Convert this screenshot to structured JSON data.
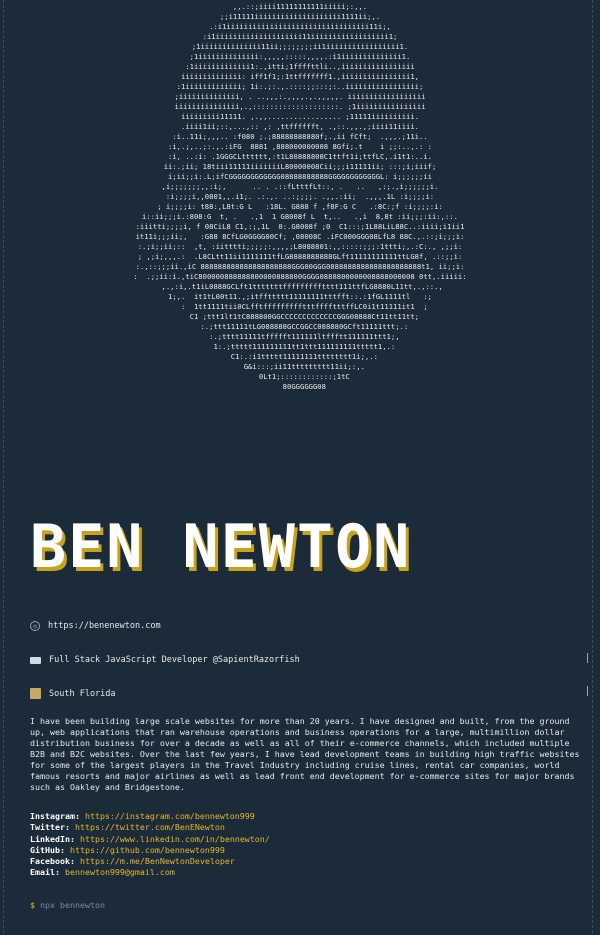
{
  "profile": {
    "name": "BEN NEWTON",
    "website": "https://benenewton.com",
    "title": "Full Stack JavaScript Developer @SapientRazorfish",
    "location": "South Florida",
    "bio": "I have been building large scale websites for more than 20 years. I have designed and built, from the ground up, web applications that ran warehouse operations and business operations for a large, multimillion dollar distribution business for over a decade as well as all of their e-commerce channels, which included multiple B2B and B2C websites. Over the last few years, I have lead development teams in building high traffic websites for some of the largest players in the Travel Industry including cruise lines, rental car companies, world famous resorts and major airlines as well as lead front end development for e-commerce sites for major brands such as Oakley and Bridgestone."
  },
  "icons": {
    "website": "globe-icon",
    "title": "laptop-icon",
    "location": "cityscape-icon"
  },
  "social": [
    {
      "label": "Instagram:",
      "url": "https://instagram.com/bennewton999"
    },
    {
      "label": "Twitter:",
      "url": "https://twitter.com/BenENewton"
    },
    {
      "label": "LinkedIn:",
      "url": "https://www.linkedin.com/in/bennewton/"
    },
    {
      "label": "GitHub:",
      "url": "https://github.com/bennewton999"
    },
    {
      "label": "Facebook:",
      "url": "https://m.me/BenNewtonDeveloper"
    },
    {
      "label": "Email:",
      "url": "bennewton999@gmail.com"
    }
  ],
  "terminal": {
    "prompt_symbol": "$",
    "command": "npx bennewton"
  },
  "ascii_portrait": ",,.::;iiii11111111111iiiii;:,,.\n;;i11111iiiiiiiiiiiiiiiiiiii1111ii;,.\n.:i1iiiiiiiiiiiiiiiiiiiiiiiiiiiiiiiii11i;,\n:i1iiiiiiiiiiiiiiiiiiii11iiiiiiiiiiiiiiiiii1;\n;1iiiiiiiiiiiiii11ii;;;;;;;;ii1iiiiiiiiiiiiiiiii1.\n;1iiiiiiiiiiiiii:,,,,,:::::,,,,.:i1iiiiiiiiiiiiii1.\n:1iiiiiiiiiiiii1:.,itti;1ffffttli..,iiiiiiiiiiiiiiiii\niiiiiiiiiiiiii: iff1f1;:1ttfffffff1.,iiiiiiiiiiiiiiii1,\n:1iiiiiiiiiiiii; 1i:.;:.,.::::;;:::;:..iiiiiiiiiiiiiiiii;\n;iiiiiiiiiiiiii, . ..,,,:.,,,,.,.,,,,,. iiiiiiiiiiiiiiiiii\niiiiiiiiiiiiiii,.,::::::::::::::::::::. ;1iiiiiiiiiiiiiiii\niiiiiiiii11111. ,.,,................. ;11111iiiiiiiiii.\n.iiii1ii;::,...,:: ,: ,ttfffffft, .,::.,,.,;iiii11iiii.\n:i..11i;,,,.. :f080 ;.;88888888880f;.,ii fCft;  .,,,.;11i..\n:i,.;,..;:.,.:iFG  8881 ,888000000008 8Gfi;.t    i ;;:..,.: :\n:i, ..:i: .1GGGCLtttttt,:t1L80888808C1ttft1i;ttfLC,.i1t1:..i.\nii:.;ii; 18tiii11111iiiiiiiL80000008Cii;;;i11111ii; :::;i;iiif;\ni;ii;;i:.L;ifCGGGGGGGGGGGG08888888888GGGGGGGGGGGGL: i;;;;;;ii\n,i;;;;;;;,,:i;,      .. . .::fLtttfLt::, .   ..   ,:;.,i;;;;;;i.\n:i;;;;i,,0801,,.i1;. .:.,. ..:;;;;. .,,.:ii;  .,,,.1L :i;;;;i:\n; i;;;;i: t88:,L8t:G L   :18L. G888 f ,f8F:G C   .:8C:;f :i;;;;:i:\ni::ii;;;i.:808:G  t, .   .,1  1 G8008f L  t,..   .,i  8,8t :ii;;;:ii:,::.\n:iiitti;;;;i, f 08CiL8 C1,:;,1L  0:.G8008f ;0  C1:::;1L88LiL88C..:iiii;i1ii1\nit11i;;;ii;,   :G88 8CfLG0GGGG00Cf; ,08008C .iFC000GGG08LfL8 88C.,.::;i;;;i:\n:.;i;;ii;::  ,t, :iitttti;;;;;:,,,,;L8088801:,,:::::;;;:1ttti;,.:C:., ,;;i:\n; ,;i;,,,.:  .L8CLtt11ii1111111tfLG8888888888GLft11111111111ttLG8f, .::;;i:\n:.,::;;;ii.,iC 888888888888888888888GGG00GGG0888888888888888888888t1, ii;;i:\n:  .;;ii:i.,tiC800000888888800000888800GGGG0888800000008888000008 0tt,.iiiii:\n ,.,:i,.t1iL0888GCLft1tttttttffffffffftttt111ttfLG8880L11tt,.,::.,\n1;,.  it1tL00t11.,;itffttttt11111111tttfft::.:1fGL1111tl   :;\n  :  1tt1111tii0CLfftffffffffftttfffftttffLC0i1t11111it1  ;\n  C1 ;ttt1lt1tC888800GGCCCCCCCCCCCCCGGG08888Ct11tt11tt;\n  :.;ttt11111tLG088888GCCGGCC088880GCft11111ttt;.:\n  :.;tttt11111tffffft111111ltffftt111111ttt1;,\n  1:.;ttttt111111111tt1ttt111111111ttttt1,.:\n  C1:.:i1ttttt11111111tttttttt1i;,.:\n  G&i:::;ii11ttttttttt11ii;:,.\n  0Lt1;::::::::::::;1tC\n  80GGGGGG08"
}
